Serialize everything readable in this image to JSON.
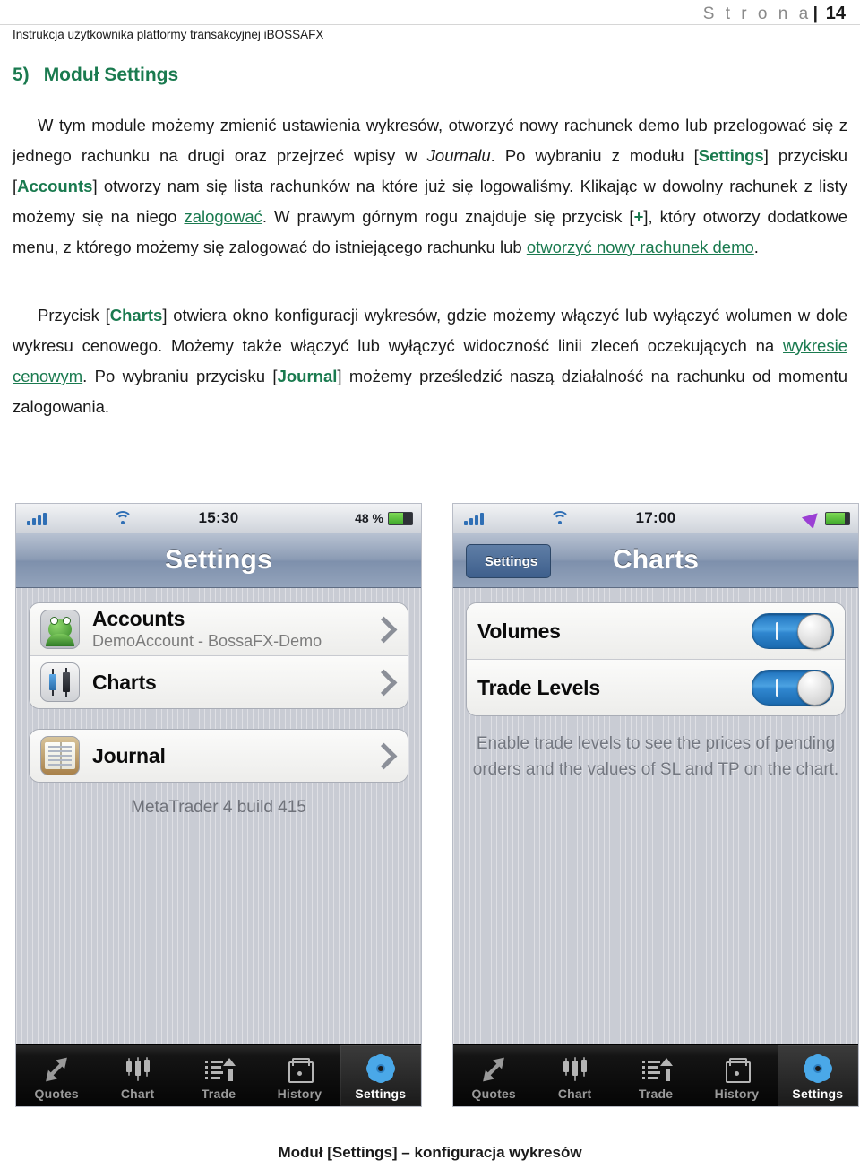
{
  "header": {
    "page_word": "S t r o n a",
    "page_separator": "|",
    "page_number": "14",
    "doc_subtitle": "Instrukcja użytkownika platformy transakcyjnej iBOSSAFX"
  },
  "section": {
    "number": "5)",
    "title": "Moduł Settings"
  },
  "paragraphs": {
    "p1_a": "W tym module możemy zmienić ustawienia wykresów, otworzyć nowy rachunek demo lub przelogować się z jednego rachunku na drugi oraz przejrzeć wpisy w ",
    "p1_journalu": "Journalu",
    "p1_b": ". Po wybraniu z modułu [",
    "p1_settings": "Settings",
    "p1_c": "] przycisku [",
    "p1_accounts": "Accounts",
    "p1_d": "] otworzy nam się lista rachunków na które już się logowaliśmy. Klikając w dowolny rachunek z listy możemy się na niego ",
    "p1_link_zalogowac": "zalogować",
    "p1_e": ". W prawym górnym rogu znajduje się przycisk [",
    "p1_plus": "+",
    "p1_f": "], który otworzy dodatkowe menu, z którego możemy się zalogować do istniejącego rachunku lub ",
    "p1_link_demo": "otworzyć nowy rachunek demo",
    "p1_g": ".",
    "p2_a": "Przycisk [",
    "p2_charts": "Charts",
    "p2_b": "] otwiera okno konfiguracji wykresów, gdzie możemy włączyć lub wyłączyć wolumen w dole wykresu cenowego. Możemy także włączyć lub wyłączyć widoczność linii zleceń oczekujących na ",
    "p2_link_wykres": "wykresie cenowym",
    "p2_c": ". Po wybraniu przycisku [",
    "p2_journal": "Journal",
    "p2_d": "] możemy prześledzić naszą działalność na rachunku od momentu zalogowania."
  },
  "phone_left": {
    "status": {
      "time": "15:30",
      "battery_percent": "48 %"
    },
    "nav_title": "Settings",
    "rows": [
      {
        "primary": "Accounts",
        "secondary": "DemoAccount - BossaFX-Demo"
      },
      {
        "primary": "Charts",
        "secondary": ""
      },
      {
        "primary": "Journal",
        "secondary": ""
      }
    ],
    "footnote": "MetaTrader 4 build 415",
    "tabs": [
      {
        "label": "Quotes",
        "active": false
      },
      {
        "label": "Chart",
        "active": false
      },
      {
        "label": "Trade",
        "active": false
      },
      {
        "label": "History",
        "active": false
      },
      {
        "label": "Settings",
        "active": true
      }
    ]
  },
  "phone_right": {
    "status": {
      "time": "17:00"
    },
    "back_label": "Settings",
    "nav_title": "Charts",
    "toggles": [
      {
        "label": "Volumes",
        "state": "on"
      },
      {
        "label": "Trade Levels",
        "state": "on"
      }
    ],
    "hint": "Enable trade levels to see the prices of pending orders and the values of SL and TP on the chart.",
    "tabs": [
      {
        "label": "Quotes",
        "active": false
      },
      {
        "label": "Chart",
        "active": false
      },
      {
        "label": "Trade",
        "active": false
      },
      {
        "label": "History",
        "active": false
      },
      {
        "label": "Settings",
        "active": true
      }
    ]
  },
  "caption": "Moduł [Settings] – konfiguracja wykresów",
  "colors": {
    "accent_green": "#1a7a4f",
    "toggle_blue": "#2f86cf",
    "navbar_blue": "#8b9bb4"
  }
}
